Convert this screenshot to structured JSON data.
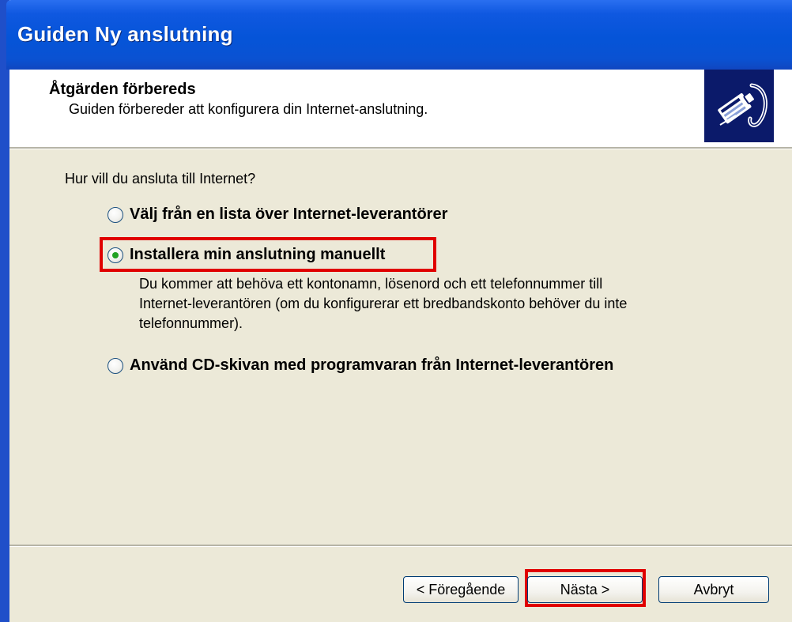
{
  "window": {
    "title": "Guiden Ny anslutning"
  },
  "header": {
    "title": "Åtgärden förbereds",
    "subtitle": "Guiden förbereder att konfigurera din Internet-anslutning.",
    "icon": "network-cable-icon"
  },
  "main": {
    "question": "Hur vill du ansluta till Internet?",
    "options": [
      {
        "label": "Välj från en lista över Internet-leverantörer",
        "selected": false
      },
      {
        "label": "Installera min anslutning manuellt",
        "selected": true
      },
      {
        "label": "Använd CD-skivan med programvaran från Internet-leverantören",
        "selected": false
      }
    ],
    "description_lines": [
      "Du kommer att behöva ett kontonamn, lösenord och ett telefonnummer till",
      "Internet-leverantören (om du konfigurerar ett bredbandskonto behöver du inte",
      "telefonnummer)."
    ]
  },
  "buttons": {
    "back": "< Föregående",
    "next": "Nästa >",
    "cancel": "Avbryt"
  },
  "colors": {
    "titlebar": "#0554d8",
    "body": "#ece9d8",
    "highlight": "#e00000",
    "radio_dot": "#21a121"
  }
}
